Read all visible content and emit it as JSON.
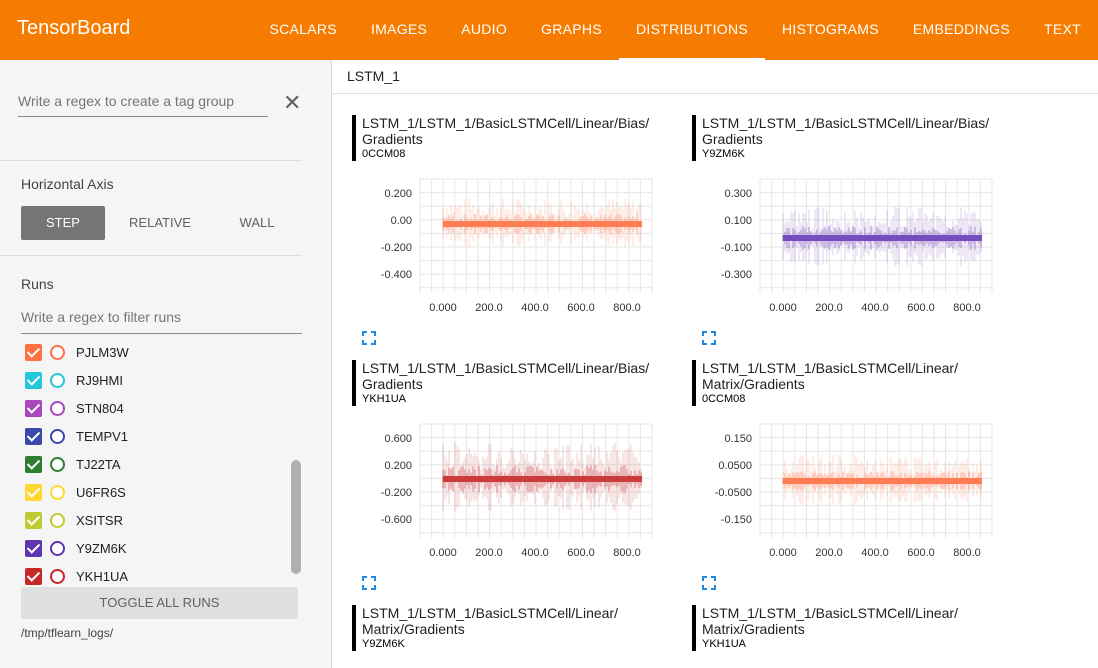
{
  "app": {
    "title": "TensorBoard"
  },
  "nav": {
    "tabs": [
      "SCALARS",
      "IMAGES",
      "AUDIO",
      "GRAPHS",
      "DISTRIBUTIONS",
      "HISTOGRAMS",
      "EMBEDDINGS",
      "TEXT"
    ],
    "active": "DISTRIBUTIONS"
  },
  "sidebar": {
    "tag_group_placeholder": "Write a regex to create a tag group",
    "horizontal_axis_label": "Horizontal Axis",
    "axis_options": [
      "STEP",
      "RELATIVE",
      "WALL"
    ],
    "axis_selected": "STEP",
    "runs_label": "Runs",
    "run_filter_placeholder": "Write a regex to filter runs",
    "runs": [
      {
        "name": "PJLM3W",
        "color": "#ff7043"
      },
      {
        "name": "RJ9HMI",
        "color": "#26c6da"
      },
      {
        "name": "STN804",
        "color": "#ab47bc"
      },
      {
        "name": "TEMPV1",
        "color": "#3949ab"
      },
      {
        "name": "TJ22TA",
        "color": "#2e7d32"
      },
      {
        "name": "U6FR6S",
        "color": "#fdd835"
      },
      {
        "name": "XSITSR",
        "color": "#c0ca33"
      },
      {
        "name": "Y9ZM6K",
        "color": "#5e35b1"
      },
      {
        "name": "YKH1UA",
        "color": "#c62828"
      }
    ],
    "toggle_all_label": "TOGGLE ALL RUNS",
    "logdir": "/tmp/tflearn_logs/"
  },
  "main": {
    "group_name": "LSTM_1",
    "cards": [
      {
        "title": "LSTM_1/LSTM_1/BasicLSTMCell/Linear/Bias/\nGradients",
        "run": "0CCM08",
        "color": "#ff7043",
        "yticks": [
          "0.200",
          "0.00",
          "-0.200",
          "-0.400"
        ],
        "xticks": [
          "0.000",
          "200.0",
          "400.0",
          "600.0",
          "800.0"
        ]
      },
      {
        "title": "LSTM_1/LSTM_1/BasicLSTMCell/Linear/Bias/\nGradients",
        "run": "Y9ZM6K",
        "color": "#673ab7",
        "yticks": [
          "0.300",
          "0.100",
          "-0.100",
          "-0.300"
        ],
        "xticks": [
          "0.000",
          "200.0",
          "400.0",
          "600.0",
          "800.0"
        ]
      },
      {
        "title": "LSTM_1/LSTM_1/BasicLSTMCell/Linear/Bias/\nGradients",
        "run": "YKH1UA",
        "color": "#c62828",
        "yticks": [
          "0.600",
          "0.200",
          "-0.200",
          "-0.600"
        ],
        "xticks": [
          "0.000",
          "200.0",
          "400.0",
          "600.0",
          "800.0"
        ]
      },
      {
        "title": "LSTM_1/LSTM_1/BasicLSTMCell/Linear/\nMatrix/Gradients",
        "run": "0CCM08",
        "color": "#ff7043",
        "yticks": [
          "0.150",
          "0.0500",
          "-0.0500",
          "-0.150"
        ],
        "xticks": [
          "0.000",
          "200.0",
          "400.0",
          "600.0",
          "800.0"
        ]
      },
      {
        "title": "LSTM_1/LSTM_1/BasicLSTMCell/Linear/\nMatrix/Gradients",
        "run": "Y9ZM6K"
      },
      {
        "title": "LSTM_1/LSTM_1/BasicLSTMCell/Linear/\nMatrix/Gradients",
        "run": "YKH1UA"
      }
    ]
  }
}
